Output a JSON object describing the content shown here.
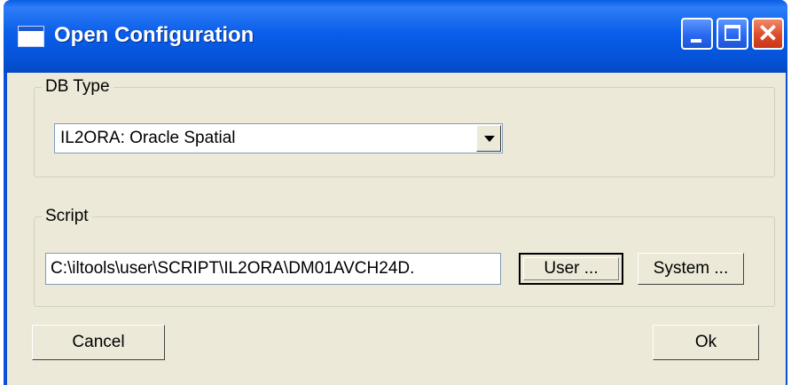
{
  "window": {
    "title": "Open Configuration"
  },
  "db_type": {
    "group_label": "DB Type",
    "selected_value": "IL2ORA: Oracle Spatial"
  },
  "script": {
    "group_label": "Script",
    "path_value": "C:\\iltools\\user\\SCRIPT\\IL2ORA\\DM01AVCH24D.",
    "user_button_label": "User ...",
    "system_button_label": "System ..."
  },
  "footer": {
    "cancel_label": "Cancel",
    "ok_label": "Ok"
  },
  "colors": {
    "titlebar": "#0553d8",
    "client_bg": "#ece9d8",
    "close_button": "#dd4b2a"
  },
  "icons": [
    "window-icon",
    "minimize-icon",
    "maximize-icon",
    "close-icon",
    "dropdown-arrow-icon"
  ]
}
